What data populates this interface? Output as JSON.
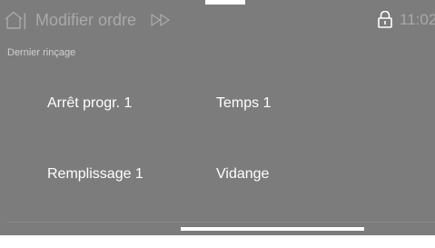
{
  "header": {
    "separator": "|",
    "title": "Modifier ordre",
    "time": "11:02",
    "icons": [
      "home-icon",
      "fast-forward-icon",
      "lock-icon"
    ]
  },
  "subtitle": "Dernier rinçage",
  "options": [
    {
      "label": "Arrêt progr. 1"
    },
    {
      "label": "Temps 1"
    },
    {
      "label": "Remplissage 1"
    },
    {
      "label": "Vidange"
    }
  ],
  "colors": {
    "background": "#7c7c7d",
    "header_text": "#a9a9aa",
    "text": "#ffffff",
    "indicator": "#ffffff"
  }
}
